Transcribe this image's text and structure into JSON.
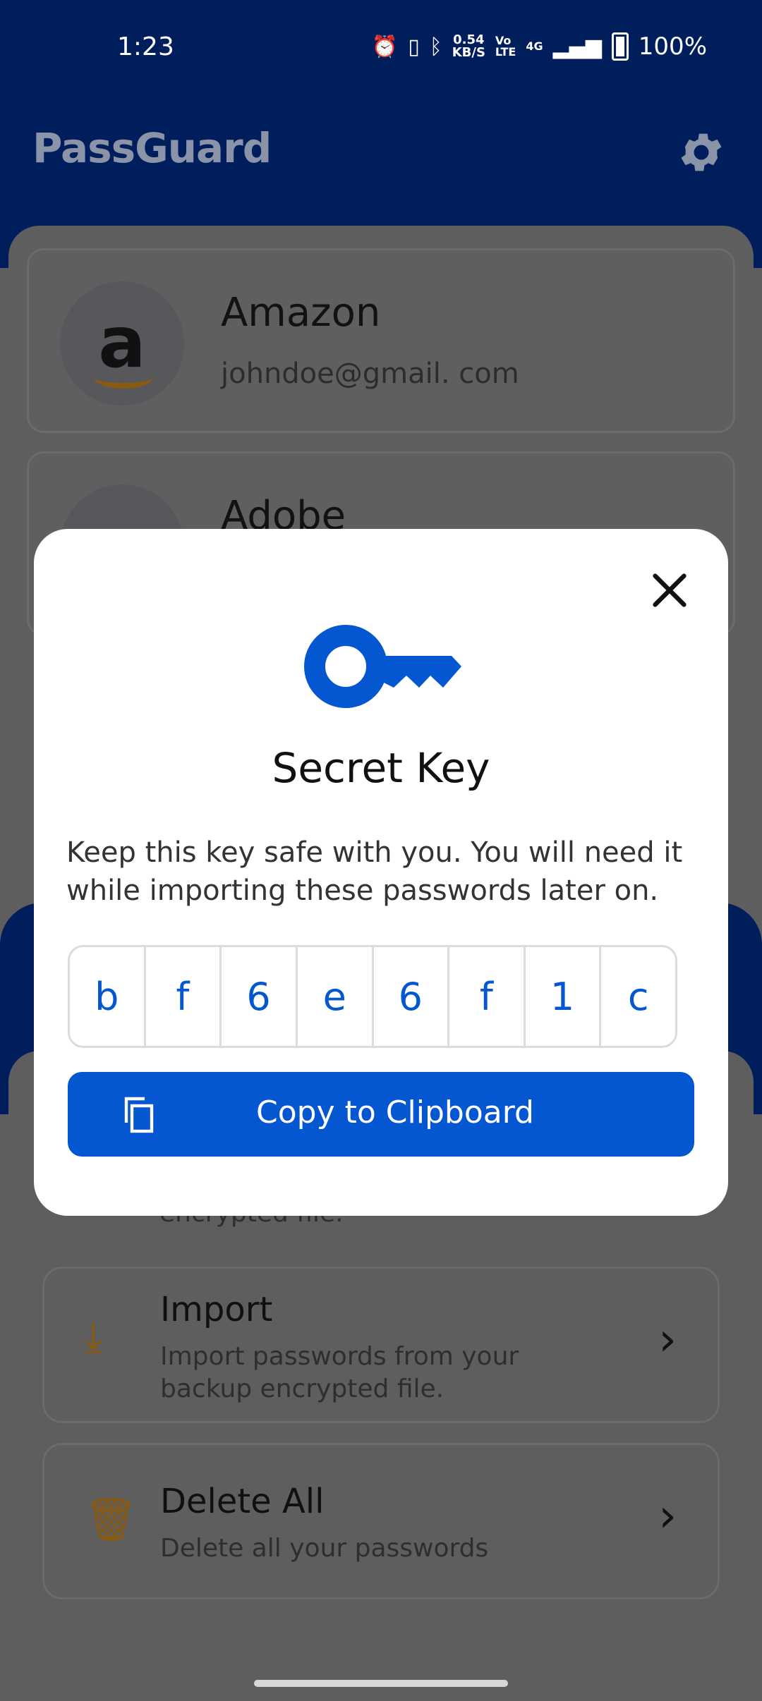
{
  "status_bar": {
    "time": "1:23",
    "speed_value": "0.54",
    "speed_unit": "KB/S",
    "network": "4G",
    "volte_top": "Vo",
    "volte_bottom": "LTE",
    "battery": "100%"
  },
  "app": {
    "title": "PassGuard"
  },
  "accounts": [
    {
      "name": "Amazon",
      "email": "johndoe@gmail. com"
    },
    {
      "name": "Adobe",
      "email": ""
    }
  ],
  "actions": {
    "export_desc_partial": "encrypted file.",
    "import": {
      "title": "Import",
      "desc": "Import passwords from your backup encrypted file."
    },
    "delete_all": {
      "title": "Delete All",
      "desc": "Delete all your passwords"
    }
  },
  "dialog": {
    "title": "Secret Key",
    "description": "Keep this key safe with you.  You will need it while importing these passwords later on.",
    "key_chars": [
      "b",
      "f",
      "6",
      "e",
      "6",
      "f",
      "1",
      "c"
    ],
    "copy_button": "Copy to Clipboard"
  },
  "colors": {
    "primary": "#0457d1",
    "header": "#001e5c",
    "scrim": "#5e5e5e",
    "accent_icon": "#8a5a12"
  },
  "icons": {
    "close": "close-icon",
    "key": "key-icon",
    "copy": "copy-icon",
    "settings": "gear-icon"
  }
}
